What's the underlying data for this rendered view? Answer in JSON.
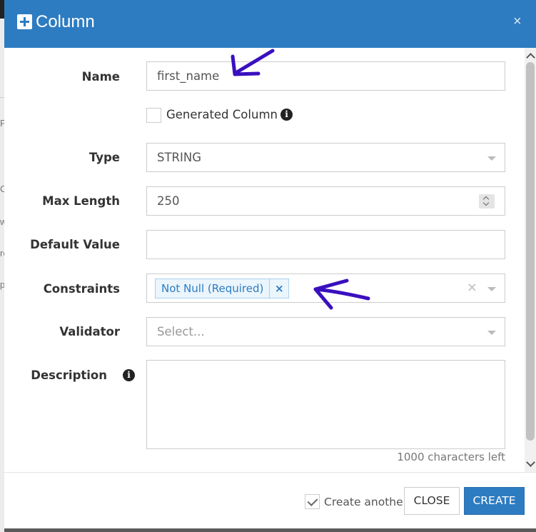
{
  "dialog": {
    "title": "Column",
    "close_glyph": "×"
  },
  "fields": {
    "name": {
      "label": "Name",
      "value": "first_name"
    },
    "generated": {
      "label": "Generated Column",
      "checked": false
    },
    "type": {
      "label": "Type",
      "value": "STRING"
    },
    "max_length": {
      "label": "Max Length",
      "value": "250"
    },
    "default_value": {
      "label": "Default Value",
      "value": ""
    },
    "constraints": {
      "label": "Constraints",
      "tags": [
        "Not Null (Required)"
      ],
      "tag_remove_glyph": "×",
      "clear_glyph": "×"
    },
    "validator": {
      "label": "Validator",
      "placeholder": "Select..."
    },
    "description": {
      "label": "Description",
      "chars_left": "1000 characters left"
    }
  },
  "footer": {
    "create_another_label": "Create another",
    "create_another_checked": true,
    "close_label": "CLOSE",
    "create_label": "CREATE"
  },
  "icons": {
    "info_glyph": "i"
  },
  "annotation_color": "#3a0fbf",
  "colors": {
    "header": "#2d7cc1",
    "tag_bg": "#eaf5fc",
    "primary_button": "#2d7cc1"
  }
}
